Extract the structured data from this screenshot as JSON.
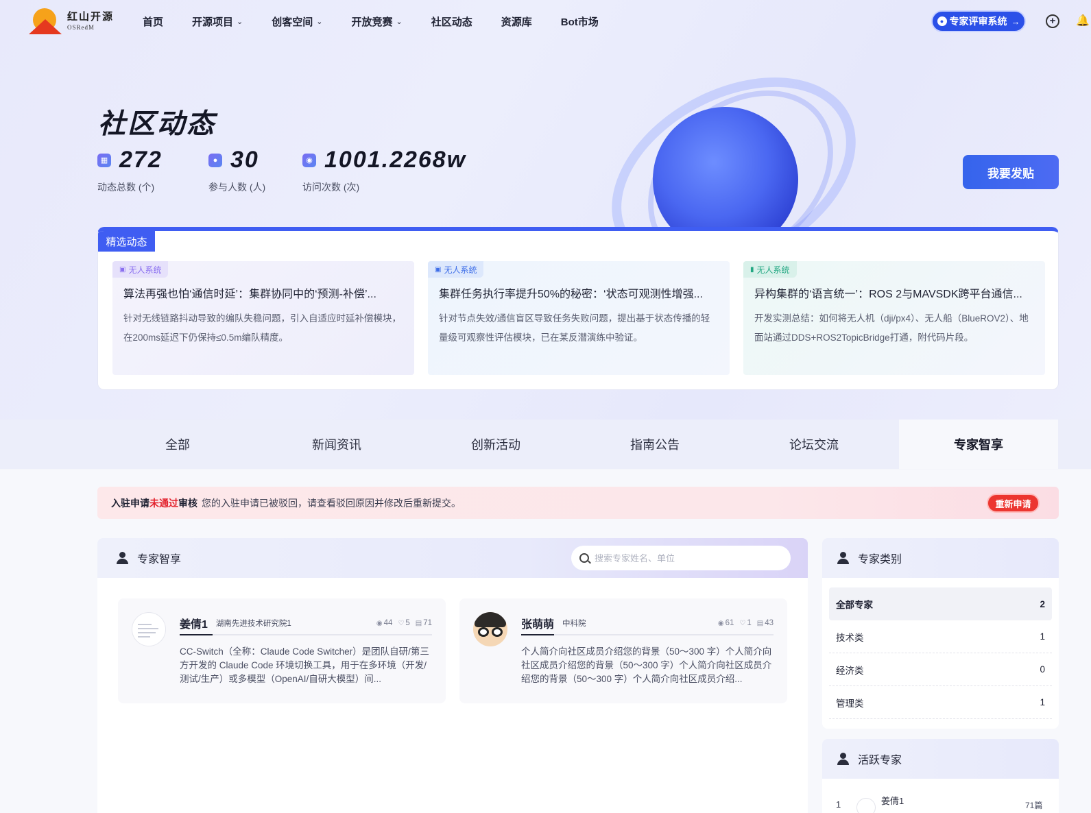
{
  "nav": {
    "logo_cn": "红山开源",
    "logo_en": "OSRedM",
    "items": [
      {
        "label": "首页",
        "dropdown": false
      },
      {
        "label": "开源项目",
        "dropdown": true
      },
      {
        "label": "创客空间",
        "dropdown": true
      },
      {
        "label": "开放竞赛",
        "dropdown": true
      },
      {
        "label": "社区动态",
        "dropdown": false
      },
      {
        "label": "资源库",
        "dropdown": false
      },
      {
        "label": "Bot市场",
        "dropdown": false
      }
    ],
    "expert_button": "专家评审系统",
    "icons": [
      "plus-circle-icon",
      "bell-icon"
    ]
  },
  "hero": {
    "title": "社区动态",
    "stats": [
      {
        "value": "272",
        "label": "动态总数 (个)",
        "icon": "chart-icon"
      },
      {
        "value": "30",
        "label": "参与人数 (人)",
        "icon": "person-icon"
      },
      {
        "value": "1001.2268w",
        "label": "访问次数 (次)",
        "icon": "eye-icon"
      }
    ],
    "post_button": "我要发贴"
  },
  "featured": {
    "tag": "精选动态",
    "cards": [
      {
        "badge": "无人系统",
        "title": "算法再强也怕‘通信时延’：集群协同中的‘预测-补偿’...",
        "desc": "针对无线链路抖动导致的编队失稳问题，引入自适应时延补偿模块，在200ms延迟下仍保持≤0.5m编队精度。"
      },
      {
        "badge": "无人系统",
        "title": "集群任务执行率提升50%的秘密：‘状态可观测性增强...",
        "desc": "针对节点失效/通信盲区导致任务失败问题，提出基于状态传播的轻量级可观察性评估模块，已在某反潜演练中验证。"
      },
      {
        "badge": "无人系统",
        "title": "异构集群的‘语言统一’：ROS 2与MAVSDK跨平台通信...",
        "desc": "开发实测总结：如何将无人机（dji/px4）、无人船（BlueROV2）、地面站通过DDS+ROS2TopicBridge打通，附代码片段。"
      }
    ]
  },
  "tabs": {
    "items": [
      "全部",
      "新闻资讯",
      "创新活动",
      "指南公告",
      "论坛交流",
      "专家智享"
    ],
    "active": "专家智享"
  },
  "alert": {
    "strong_before": "入驻申请",
    "red": "未通过",
    "strong_after": "审核",
    "message": "您的入驻申请已被驳回，请查看驳回原因并修改后重新提交。",
    "button": "重新申请"
  },
  "experts": {
    "title": "专家智享",
    "search_placeholder": "搜索专家姓名、单位",
    "cards": [
      {
        "name": "姜倩1",
        "org": "湖南先进技术研究院1",
        "views": "44",
        "likes": "5",
        "docs": "71",
        "desc": "CC-Switch（全称：Claude Code Switcher）是团队自研/第三方开发的 Claude Code 环境切换工具，用于在多环境（开发/测试/生产）或多模型（OpenAI/自研大模型）间..."
      },
      {
        "name": "张萌萌",
        "org": "中科院",
        "views": "61",
        "likes": "1",
        "docs": "43",
        "desc": "个人简介向社区成员介绍您的背景（50～300 字）个人简介向社区成员介绍您的背景（50～300 字）个人简介向社区成员介绍您的背景（50～300 字）个人简介向社区成员介绍..."
      }
    ]
  },
  "categories": {
    "title": "专家类别",
    "items": [
      {
        "label": "全部专家",
        "count": "2"
      },
      {
        "label": "技术类",
        "count": "1"
      },
      {
        "label": "经济类",
        "count": "0"
      },
      {
        "label": "管理类",
        "count": "1"
      }
    ]
  },
  "active_experts": {
    "title": "活跃专家",
    "items": [
      {
        "rank": "1",
        "name": "姜倩1",
        "count": "71篇"
      }
    ]
  },
  "colors": {
    "primary": "#3f5df2",
    "danger": "#ec3630",
    "text": "#1f2233"
  }
}
